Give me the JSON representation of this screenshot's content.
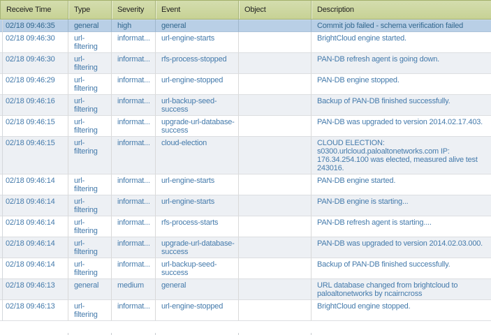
{
  "colors": {
    "header_bg": "#ccd6a0",
    "header_border": "#a6b376",
    "header_text": "#1f1f1f",
    "selected_row_bg": "#b9cfe6",
    "selected_row_text": "#33688f",
    "alt_row_bg": "#edf0f4",
    "row_text": "#447aab",
    "grid_line": "#d9d9d9"
  },
  "table": {
    "columns": [
      {
        "key": "receive_time",
        "label": "Receive Time"
      },
      {
        "key": "type",
        "label": "Type"
      },
      {
        "key": "severity",
        "label": "Severity"
      },
      {
        "key": "event",
        "label": "Event"
      },
      {
        "key": "object",
        "label": "Object"
      },
      {
        "key": "description",
        "label": "Description"
      }
    ],
    "rows": [
      {
        "selected": true,
        "receive_time": "02/18 09:46:35",
        "type": "general",
        "severity": "high",
        "event": "general",
        "object": "",
        "description": "Commit job failed - schema verification failed"
      },
      {
        "receive_time": "02/18 09:46:30",
        "type": "url-filtering",
        "severity": "informat...",
        "event": "url-engine-starts",
        "object": "",
        "description": "BrightCloud engine started."
      },
      {
        "receive_time": "02/18 09:46:30",
        "type": "url-filtering",
        "severity": "informat...",
        "event": "rfs-process-stopped",
        "object": "",
        "description": "PAN-DB refresh agent is going down."
      },
      {
        "receive_time": "02/18 09:46:29",
        "type": "url-filtering",
        "severity": "informat...",
        "event": "url-engine-stopped",
        "object": "",
        "description": "PAN-DB engine stopped."
      },
      {
        "receive_time": "02/18 09:46:16",
        "type": "url-filtering",
        "severity": "informat...",
        "event": "url-backup-seed-success",
        "object": "",
        "description": "Backup of PAN-DB finished successfully."
      },
      {
        "receive_time": "02/18 09:46:15",
        "type": "url-filtering",
        "severity": "informat...",
        "event": "upgrade-url-database-success",
        "object": "",
        "description": "PAN-DB was upgraded to version 2014.02.17.403."
      },
      {
        "receive_time": "02/18 09:46:15",
        "type": "url-filtering",
        "severity": "informat...",
        "event": "cloud-election",
        "object": "",
        "description": "CLOUD ELECTION: s0300.urlcloud.paloaltonetworks.com IP: 176.34.254.100 was elected, measured alive test 243016."
      },
      {
        "receive_time": "02/18 09:46:14",
        "type": "url-filtering",
        "severity": "informat...",
        "event": "url-engine-starts",
        "object": "",
        "description": "PAN-DB engine started."
      },
      {
        "receive_time": "02/18 09:46:14",
        "type": "url-filtering",
        "severity": "informat...",
        "event": "url-engine-starts",
        "object": "",
        "description": "PAN-DB engine is starting..."
      },
      {
        "receive_time": "02/18 09:46:14",
        "type": "url-filtering",
        "severity": "informat...",
        "event": "rfs-process-starts",
        "object": "",
        "description": "PAN-DB refresh agent is starting...."
      },
      {
        "receive_time": "02/18 09:46:14",
        "type": "url-filtering",
        "severity": "informat...",
        "event": "upgrade-url-database-success",
        "object": "",
        "description": "PAN-DB was upgraded to version 2014.02.03.000."
      },
      {
        "receive_time": "02/18 09:46:14",
        "type": "url-filtering",
        "severity": "informat...",
        "event": "url-backup-seed-success",
        "object": "",
        "description": "Backup of PAN-DB finished successfully."
      },
      {
        "receive_time": "02/18 09:46:13",
        "type": "general",
        "severity": "medium",
        "event": "general",
        "object": "",
        "description": "URL database changed from brightcloud to paloaltonetworks by ncairncross"
      },
      {
        "receive_time": "02/18 09:46:13",
        "type": "url-filtering",
        "severity": "informat...",
        "event": "url-engine-stopped",
        "object": "",
        "description": "BrightCloud engine stopped."
      }
    ]
  }
}
